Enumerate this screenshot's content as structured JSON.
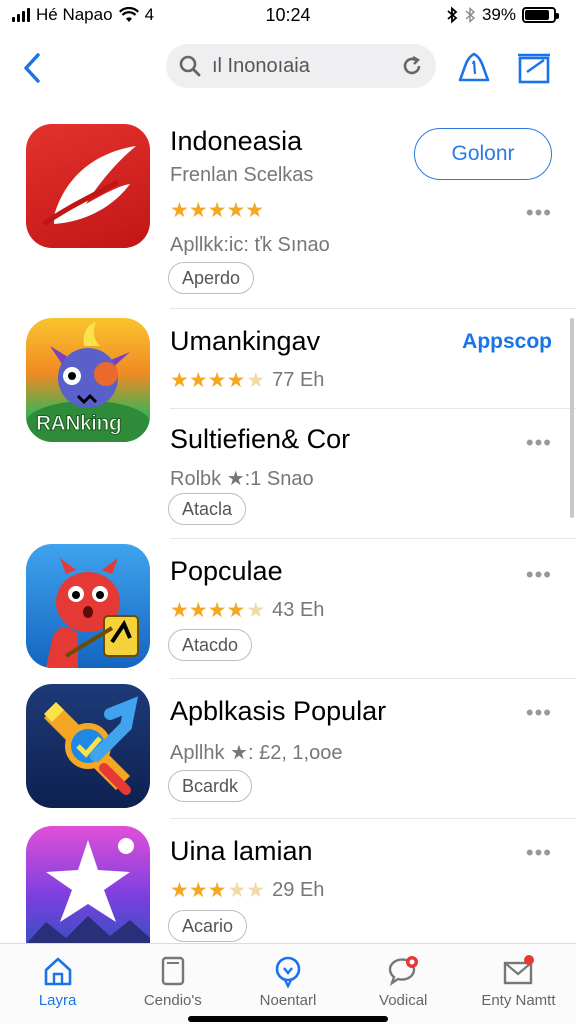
{
  "status_bar": {
    "carrier": "Hé Napao",
    "network": "4",
    "time": "10:24",
    "battery_percent": "39%"
  },
  "nav": {
    "search_text": "ıl Inonoıaia",
    "icons": [
      "back-chevron-icon",
      "search-icon",
      "refresh-icon",
      "notification-bell-icon",
      "inbox-icon"
    ]
  },
  "apps": [
    {
      "title": "Indoneasia",
      "subtitle": "Frenlan Scelkas",
      "stars": 5,
      "count": "",
      "meta": "Apllkk:ic: ťk Sınao",
      "pill": "Aperdo",
      "action": "Golonr"
    },
    {
      "title": "Umankingav",
      "subtitle": "",
      "stars": 4,
      "count": "77 Eh",
      "meta": "",
      "pill": "",
      "action": "Appscop",
      "icon_label": "RANking"
    },
    {
      "title": "Sultiefien& Cor",
      "subtitle": "Rolbk ★:1 Snao",
      "stars": 0,
      "count": "",
      "meta": "",
      "pill": "Atacla",
      "action": ""
    },
    {
      "title": "Popculae",
      "subtitle": "",
      "stars": 4.5,
      "count": "43 Eh",
      "meta": "",
      "pill": "Atacdo",
      "action": ""
    },
    {
      "title": "Apblkasis Popular",
      "subtitle": "Apllhk ★: £2, 1,ooe",
      "stars": 0,
      "count": "",
      "meta": "",
      "pill": "Bcardk",
      "action": ""
    },
    {
      "title": "Uina lamian",
      "subtitle": "",
      "stars": 3.5,
      "count": "29 Eh",
      "meta": "",
      "pill": "Acario",
      "action": ""
    }
  ],
  "tab_bar": {
    "tabs": [
      {
        "label": "Layra",
        "icon": "home-icon",
        "active": true
      },
      {
        "label": "Cendio's",
        "icon": "tablet-icon",
        "active": false
      },
      {
        "label": "Noentarl",
        "icon": "search-icon",
        "active": false
      },
      {
        "label": "Vodical",
        "icon": "chat-icon",
        "active": false
      },
      {
        "label": "Enty Namtt",
        "icon": "mail-icon",
        "active": false
      }
    ]
  },
  "colors": {
    "accent": "#1a73e8",
    "star": "#f5a623",
    "badge": "#e53935"
  }
}
